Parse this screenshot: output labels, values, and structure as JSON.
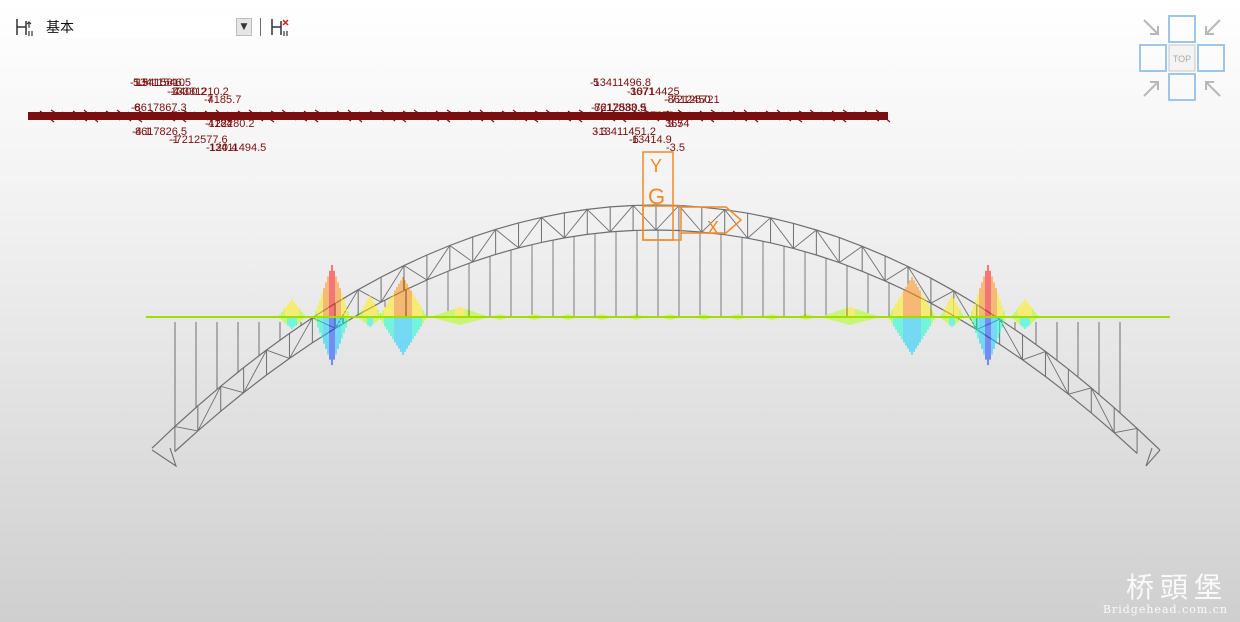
{
  "toolbar": {
    "combo_value": "基本",
    "left_icon": "member-force-icon",
    "right_icon": "member-force-toggle-icon"
  },
  "view": {
    "axis_labels": {
      "y": "Y",
      "g": "G",
      "x": "X"
    },
    "nav_cube_label": "TOP",
    "label_color": "#7a0f0f",
    "diagram_colors": [
      "#ff0000",
      "#ff8800",
      "#ffee00",
      "#aaff00",
      "#00ffcc",
      "#00ccff",
      "#0033ff"
    ],
    "left_labels": [
      "-13411546.5",
      "-13331210.2",
      "-4185.7",
      "-8617867.3",
      "-7",
      "-122280.2",
      "-4.1",
      "-1",
      "-120.4",
      "5.5",
      "-7",
      "7",
      "6",
      "9",
      "4184",
      "8617826.5",
      "-7212577.6",
      "13411494.5",
      "13415810",
      "4400.2"
    ],
    "right_labels": [
      "-13411496.8",
      "-10714425",
      "-8612450.1",
      "-7212580.5",
      "-8617872.9",
      "3674",
      "3.3",
      "-6",
      "-3.5",
      "5",
      "3671",
      "-7212572",
      "8617833.9",
      "1071441",
      "3.5",
      "-13411451.2",
      "13414.9"
    ]
  },
  "watermark": {
    "cn": "桥頭堡",
    "url": "Bridgehead.com.cn"
  }
}
